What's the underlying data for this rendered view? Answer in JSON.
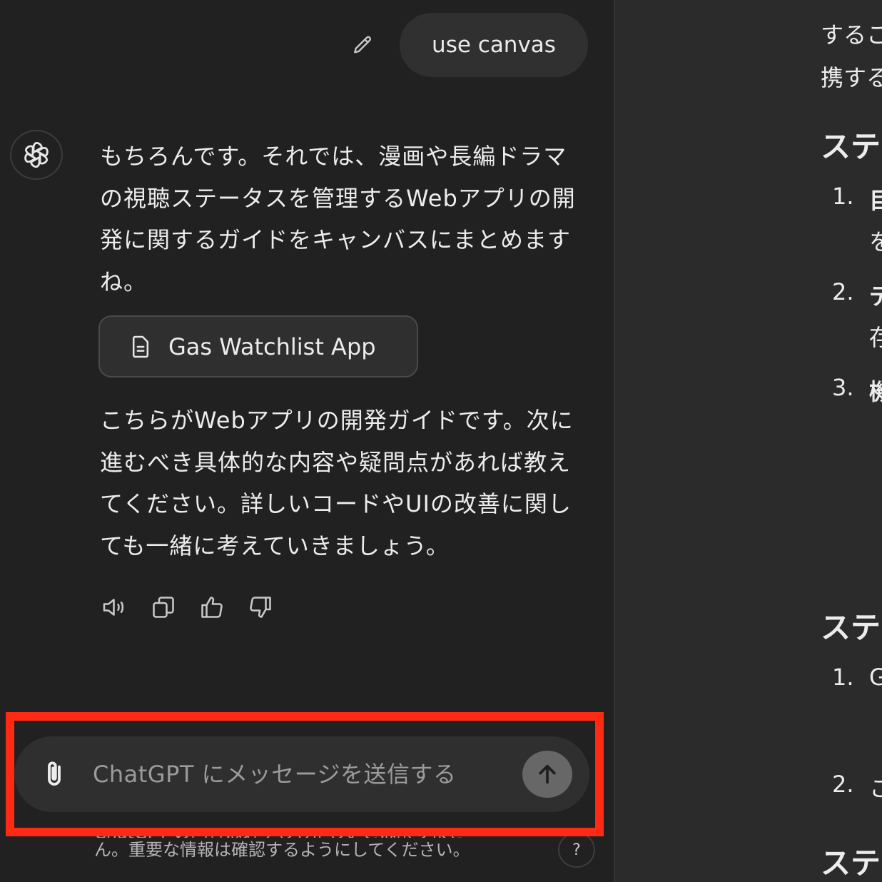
{
  "user_message": {
    "text": "use canvas"
  },
  "assistant": {
    "paragraph_1": "もちろんです。それでは、漫画や長編ドラマの視聴ステータスを管理するWebアプリの開発に関するガイドをキャンバスにまとめますね。",
    "canvas_card_title": "Gas Watchlist App",
    "paragraph_2": "こちらがWebアプリの開発ガイドです。次に進むべき具体的な内容や疑問点があれば教えてください。詳しいコードやUIの改善に関しても一緒に考えていきましょう。",
    "actions": [
      "read-aloud-icon",
      "copy-icon",
      "thumbs-up-icon",
      "thumbs-down-icon"
    ]
  },
  "composer": {
    "placeholder": "ChatGPT にメッセージを送信する",
    "value": ""
  },
  "disclaimer": {
    "line_1": "ChatGPT の回答は必ずしも正しいとは限りませ",
    "line_2": "ん。重要な情報は確認するようにしてください。"
  },
  "help_label": "?",
  "canvas_doc": {
    "top_line_1": "するこ",
    "top_line_2": "携する",
    "heading_1": "ステ",
    "items_1": [
      {
        "num": "1.",
        "title": "目",
        "sub": "を"
      },
      {
        "num": "2.",
        "title": "デ",
        "sub": "存"
      },
      {
        "num": "3.",
        "title": "機"
      }
    ],
    "heading_2": "ステ",
    "items_2": [
      {
        "num": "1.",
        "title": "G"
      },
      {
        "num": "2.",
        "title": "こ"
      }
    ],
    "heading_3": "ステ"
  },
  "colors": {
    "background": "#212121",
    "bubble": "#2f2f2f",
    "highlight": "#ff2a14",
    "send_button": "#676767"
  }
}
